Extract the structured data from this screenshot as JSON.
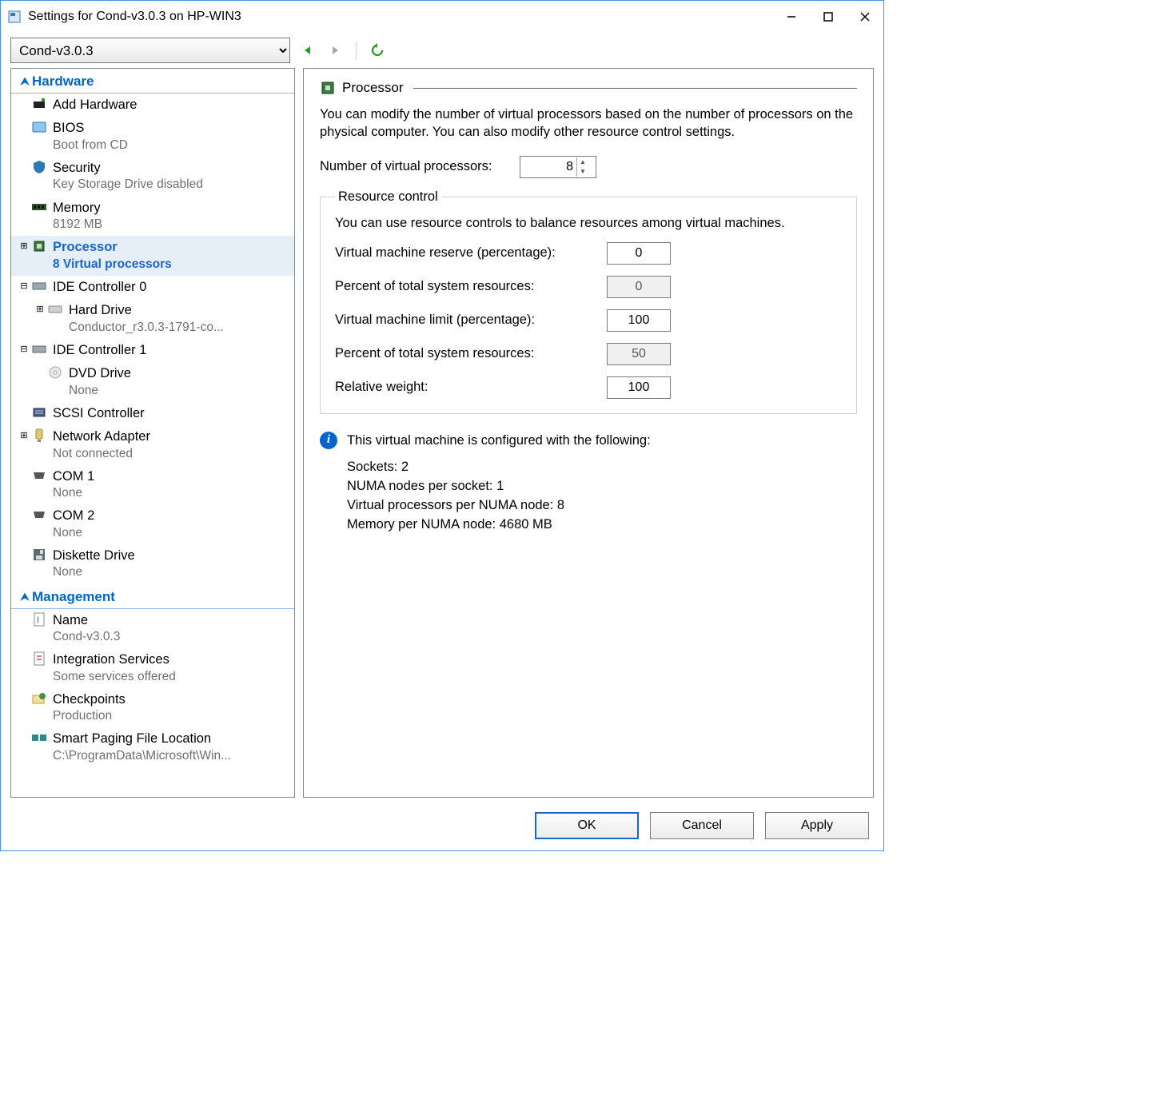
{
  "window": {
    "title": "Settings for Cond-v3.0.3 on HP-WIN3"
  },
  "toolbar": {
    "vm_name": "Cond-v3.0.3"
  },
  "nav": {
    "hardware_heading": "Hardware",
    "management_heading": "Management",
    "items": {
      "add_hardware": "Add Hardware",
      "bios": "BIOS",
      "bios_sub": "Boot from CD",
      "security": "Security",
      "security_sub": "Key Storage Drive disabled",
      "memory": "Memory",
      "memory_sub": "8192 MB",
      "processor": "Processor",
      "processor_sub": "8 Virtual processors",
      "ide0": "IDE Controller 0",
      "hard_drive": "Hard Drive",
      "hard_drive_sub": "Conductor_r3.0.3-1791-co...",
      "ide1": "IDE Controller 1",
      "dvd": "DVD Drive",
      "dvd_sub": "None",
      "scsi": "SCSI Controller",
      "net": "Network Adapter",
      "net_sub": "Not connected",
      "com1": "COM 1",
      "com1_sub": "None",
      "com2": "COM 2",
      "com2_sub": "None",
      "diskette": "Diskette Drive",
      "diskette_sub": "None",
      "name": "Name",
      "name_sub": "Cond-v3.0.3",
      "integ": "Integration Services",
      "integ_sub": "Some services offered",
      "checkpoints": "Checkpoints",
      "checkpoints_sub": "Production",
      "paging": "Smart Paging File Location",
      "paging_sub": "C:\\ProgramData\\Microsoft\\Win..."
    }
  },
  "main": {
    "heading": "Processor",
    "description": "You can modify the number of virtual processors based on the number of processors on the physical computer. You can also modify other resource control settings.",
    "vproc_label": "Number of virtual processors:",
    "vproc_value": "8",
    "resource_control": {
      "legend": "Resource control",
      "intro": "You can use resource controls to balance resources among virtual machines.",
      "reserve_label": "Virtual machine reserve (percentage):",
      "reserve_value": "0",
      "reserve_total_label": "Percent of total system resources:",
      "reserve_total_value": "0",
      "limit_label": "Virtual machine limit (percentage):",
      "limit_value": "100",
      "limit_total_label": "Percent of total system resources:",
      "limit_total_value": "50",
      "weight_label": "Relative weight:",
      "weight_value": "100"
    },
    "info_intro": "This virtual machine is configured with the following:",
    "info_lines": {
      "sockets": "Sockets: 2",
      "numa_per_socket": "NUMA nodes per socket: 1",
      "vproc_per_numa": "Virtual processors per NUMA node: 8",
      "mem_per_numa": "Memory per NUMA node: 4680 MB"
    }
  },
  "footer": {
    "ok": "OK",
    "cancel": "Cancel",
    "apply": "Apply"
  }
}
